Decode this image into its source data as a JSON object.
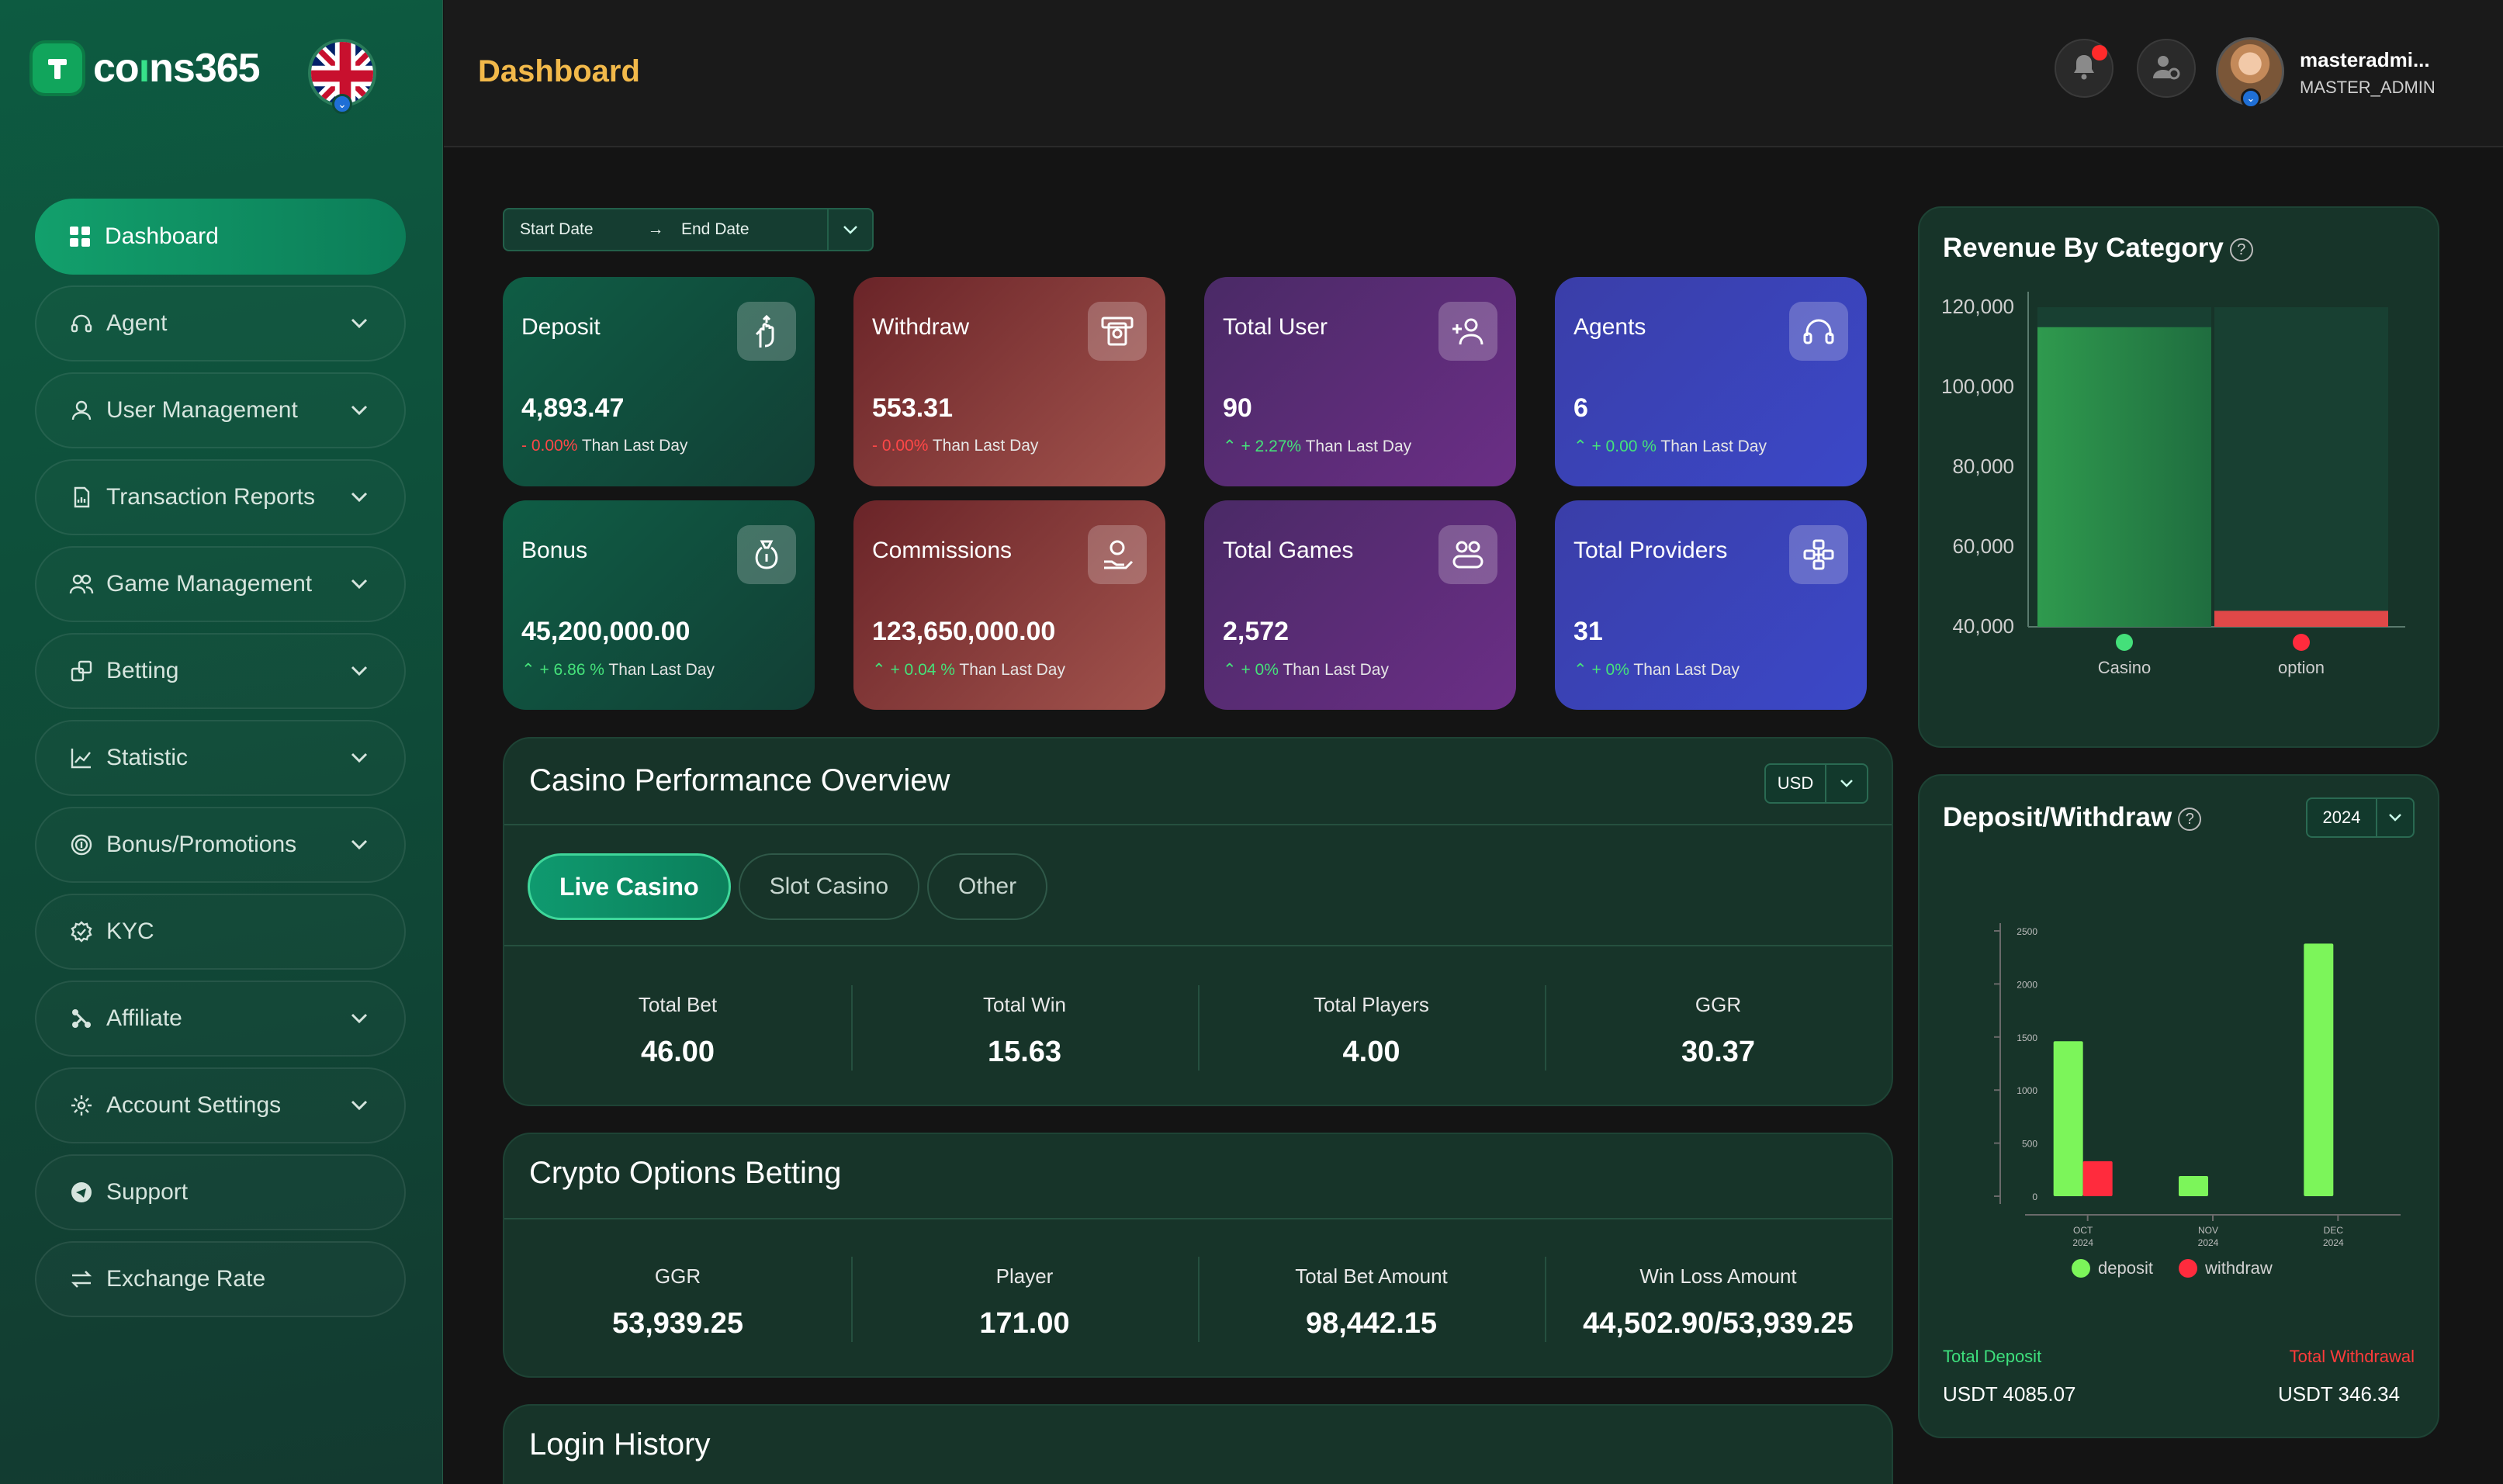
{
  "brand": {
    "name_prefix": "co",
    "name_n": "ı",
    "name_suffix": "ns365"
  },
  "header": {
    "title": "Dashboard"
  },
  "user": {
    "name": "masteradmi...",
    "role": "MASTER_ADMIN"
  },
  "sidebar": {
    "items": [
      {
        "label": "Dashboard",
        "icon": "grid-icon"
      },
      {
        "label": "Agent",
        "icon": "headset-icon"
      },
      {
        "label": "User Management",
        "icon": "user-icon"
      },
      {
        "label": "Transaction Reports",
        "icon": "report-icon"
      },
      {
        "label": "Game Management",
        "icon": "users-icon"
      },
      {
        "label": "Betting",
        "icon": "betting-icon"
      },
      {
        "label": "Statistic",
        "icon": "chart-line-icon"
      },
      {
        "label": "Bonus/Promotions",
        "icon": "coin-icon"
      },
      {
        "label": "KYC",
        "icon": "verified-icon"
      },
      {
        "label": "Affiliate",
        "icon": "affiliate-icon"
      },
      {
        "label": "Account Settings",
        "icon": "settings-icon"
      },
      {
        "label": "Support",
        "icon": "telegram-icon"
      },
      {
        "label": "Exchange Rate",
        "icon": "exchange-icon"
      }
    ]
  },
  "filters": {
    "start_date": "Start Date",
    "end_date": "End Date",
    "arrow": "→"
  },
  "cards": [
    {
      "title": "Deposit",
      "value": "4,893.47",
      "arrow": "",
      "change": "- 0.00%",
      "suffix": "Than Last Day"
    },
    {
      "title": "Withdraw",
      "value": "553.31",
      "arrow": "",
      "change": "- 0.00%",
      "suffix": "Than Last Day"
    },
    {
      "title": "Total User",
      "value": "90",
      "arrow": "⌃",
      "change": "+ 2.27%",
      "suffix": "Than Last Day"
    },
    {
      "title": "Agents",
      "value": "6",
      "arrow": "⌃",
      "change": "+ 0.00 %",
      "suffix": "Than Last Day"
    },
    {
      "title": "Bonus",
      "value": "45,200,000.00",
      "arrow": "⌃",
      "change": "+ 6.86 %",
      "suffix": "Than Last Day"
    },
    {
      "title": "Commissions",
      "value": "123,650,000.00",
      "arrow": "⌃",
      "change": "+ 0.04 %",
      "suffix": "Than Last Day"
    },
    {
      "title": "Total Games",
      "value": "2,572",
      "arrow": "⌃",
      "change": "+ 0%",
      "suffix": "Than Last Day"
    },
    {
      "title": "Total Providers",
      "value": "31",
      "arrow": "⌃",
      "change": "+ 0%",
      "suffix": "Than Last Day"
    }
  ],
  "casino": {
    "title": "Casino Performance Overview",
    "currency": "USD",
    "tabs": [
      "Live Casino",
      "Slot Casino",
      "Other"
    ],
    "stats": [
      {
        "label": "Total Bet",
        "value": "46.00"
      },
      {
        "label": "Total Win",
        "value": "15.63"
      },
      {
        "label": "Total Players",
        "value": "4.00"
      },
      {
        "label": "GGR",
        "value": "30.37"
      }
    ]
  },
  "crypto": {
    "title": "Crypto Options Betting",
    "stats": [
      {
        "label": "GGR",
        "value": "53,939.25"
      },
      {
        "label": "Player",
        "value": "171.00"
      },
      {
        "label": "Total Bet Amount",
        "value": "98,442.15"
      },
      {
        "label": "Win Loss Amount",
        "value": "44,502.90/53,939.25"
      }
    ]
  },
  "login_history": {
    "title": "Login History"
  },
  "revenue": {
    "title": "Revenue By Category",
    "help": "?"
  },
  "deposit_withdraw": {
    "title": "Deposit/Withdraw",
    "help": "?",
    "year": "2024",
    "total_deposit_label": "Total Deposit",
    "total_deposit_value": "USDT 4085.07",
    "total_withdrawal_label": "Total Withdrawal",
    "total_withdrawal_value": "USDT 346.34"
  },
  "chart_data": [
    {
      "type": "bar",
      "title": "Revenue By Category",
      "categories": [
        "Casino",
        "option"
      ],
      "ylim": [
        40000,
        120000
      ],
      "yticks": [
        "40,000",
        "60,000",
        "80,000",
        "100,000",
        "120,000"
      ],
      "series": [
        {
          "values": [
            115000,
            44000
          ]
        }
      ],
      "colors": [
        "#3aa65a",
        "#e04848"
      ]
    },
    {
      "type": "bar",
      "title": "Deposit/Withdraw",
      "categories": [
        [
          "OCT",
          "2024"
        ],
        [
          "NOV",
          "2024"
        ],
        [
          "DEC",
          "2024"
        ]
      ],
      "ylim": [
        0,
        2500
      ],
      "yticks": [
        "0",
        "500",
        "1000",
        "1500",
        "2000",
        "2500"
      ],
      "series": [
        {
          "name": "deposit",
          "values": [
            1460,
            190,
            2380
          ],
          "color": "#7cf55a"
        },
        {
          "name": "withdraw",
          "values": [
            330,
            0,
            0
          ],
          "color": "#ff2b3d"
        }
      ]
    }
  ]
}
